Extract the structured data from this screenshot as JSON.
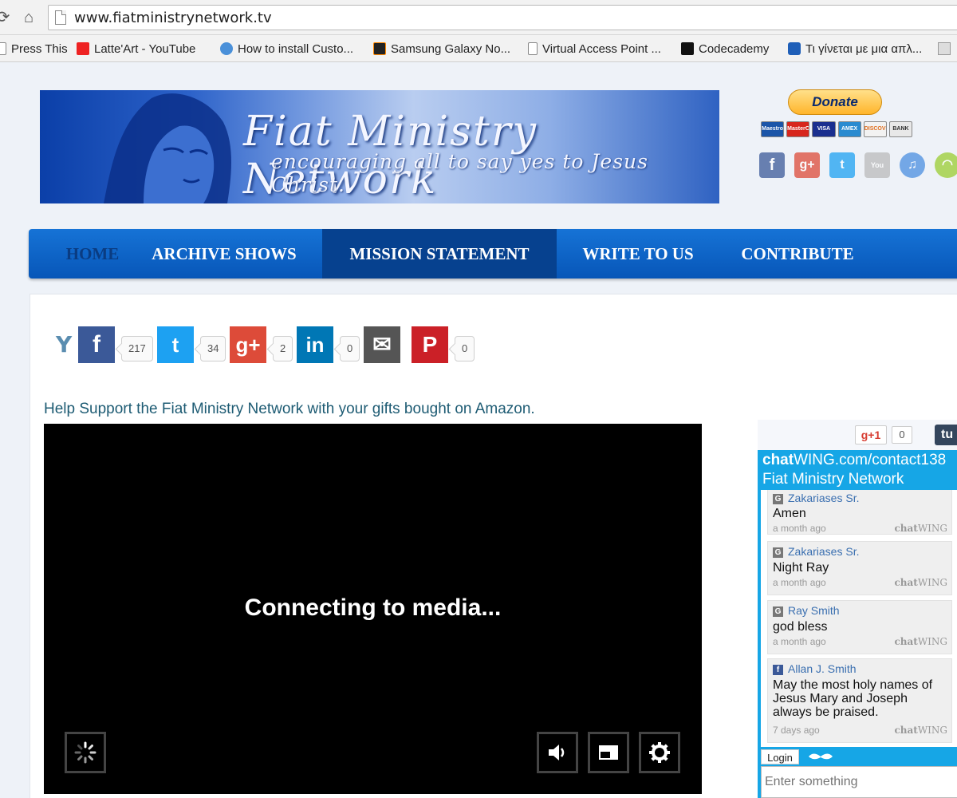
{
  "browser": {
    "url": "www.fiatministrynetwork.tv",
    "bookmarks": [
      {
        "label": "Press This",
        "icon": "page-icon"
      },
      {
        "label": "Latte'Art - YouTube",
        "icon": "youtube-icon"
      },
      {
        "label": "How to install Custo...",
        "icon": "android-icon"
      },
      {
        "label": "Samsung Galaxy No...",
        "icon": "xda-icon"
      },
      {
        "label": "Virtual Access Point ...",
        "icon": "page-icon"
      },
      {
        "label": "Codecademy",
        "icon": "codecademy-icon"
      },
      {
        "label": "Τι γίνεται με μια απλ...",
        "icon": "site-icon"
      }
    ]
  },
  "header": {
    "logo_title": "Fiat Ministry Network",
    "logo_tagline": "encouraging all to say yes to Jesus Christ.",
    "donate_label": "Donate",
    "cards": [
      "Maestro",
      "MasterCard",
      "VISA",
      "AMEX",
      "DISCOVER",
      "BANK"
    ]
  },
  "nav": {
    "items": [
      "HOME",
      "ARCHIVE SHOWS",
      "MISSION STATEMENT",
      "WRITE TO US",
      "CONTRIBUTE"
    ]
  },
  "share": {
    "y_glyph": "Y",
    "facebook": {
      "glyph": "f",
      "count": "217"
    },
    "twitter": {
      "glyph": "t",
      "count": "34"
    },
    "googleplus": {
      "glyph": "g+",
      "count": "2"
    },
    "linkedin": {
      "glyph": "in",
      "count": "0"
    },
    "email": {
      "glyph": "✉"
    },
    "pinterest": {
      "glyph": "P",
      "count": "0"
    }
  },
  "main": {
    "support_text": "Help Support the Fiat Ministry Network with your gifts bought on Amazon.",
    "player_message": "Connecting to media..."
  },
  "widget": {
    "gplus_label": "g+1",
    "gplus_count": "0",
    "tumblr_label": "tu",
    "chat_title_bold": "chat",
    "chat_title_rest": "WING.com/contact138",
    "chat_room": "Fiat Ministry Network",
    "messages": [
      {
        "user": "Zakariases Sr.",
        "text": "Amen",
        "time": "a month ago",
        "source": "G"
      },
      {
        "user": "Zakariases Sr.",
        "text": "Night Ray",
        "time": "a month ago",
        "source": "G"
      },
      {
        "user": "Ray Smith",
        "text": "god bless",
        "time": "a month ago",
        "source": "G"
      },
      {
        "user": "Allan J. Smith",
        "text": "May the most holy names of Jesus Mary and Joseph always be praised.",
        "time": "7 days ago",
        "source": "f"
      }
    ],
    "brand_bold": "chat",
    "brand_rest": "WING",
    "login_label": "Login",
    "input_placeholder": "Enter something"
  },
  "colors": {
    "nav_blue": "#0b63c9",
    "chat_blue": "#16a6e6",
    "link_teal": "#1d5b73"
  }
}
